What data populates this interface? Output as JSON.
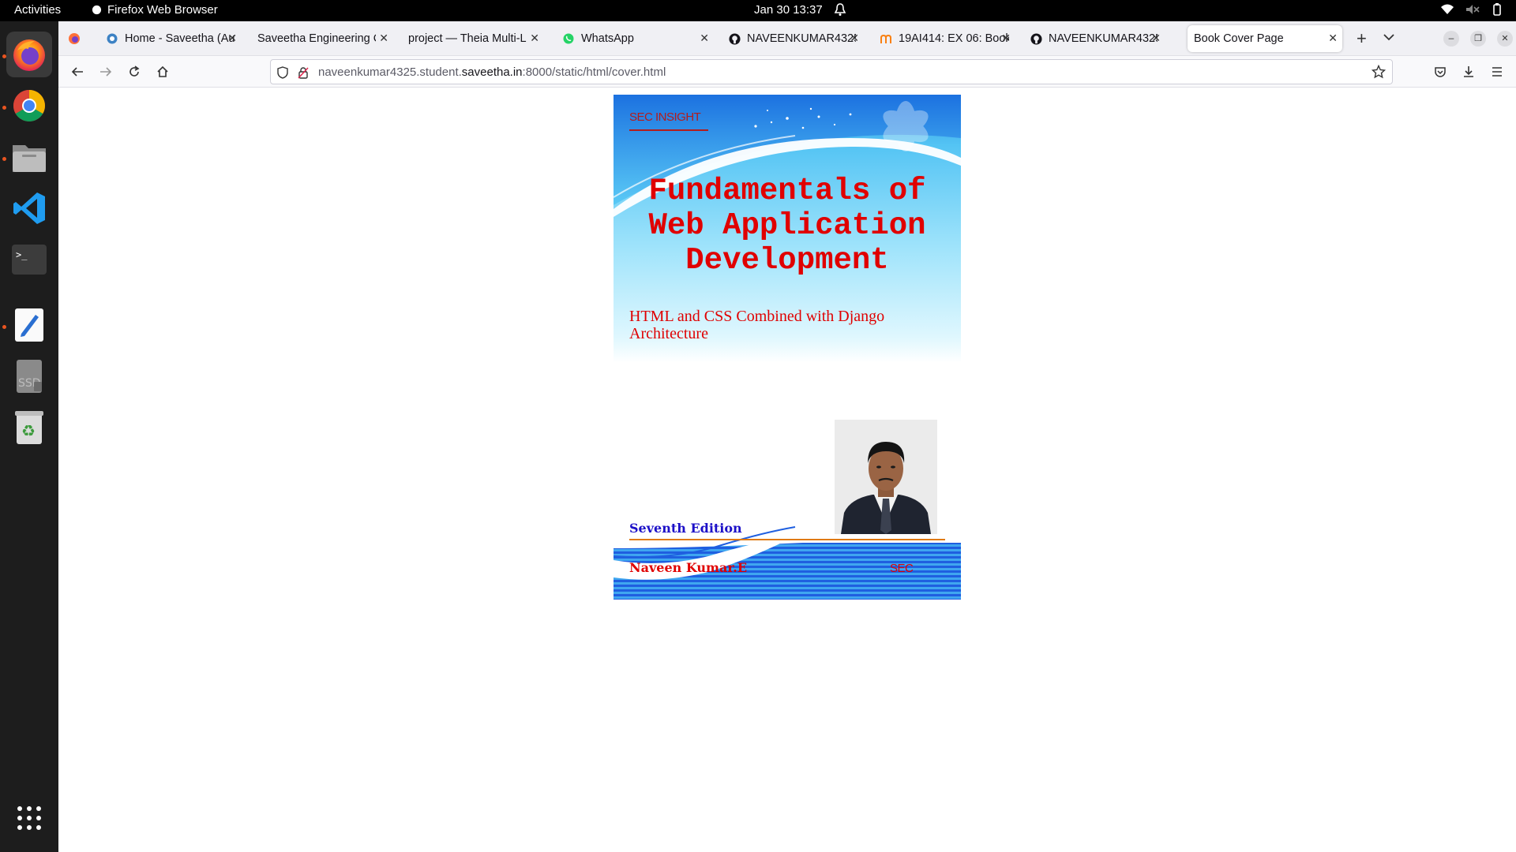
{
  "topbar": {
    "activities": "Activities",
    "app_name": "Firefox Web Browser",
    "clock": "Jan 30  13:37"
  },
  "dock": {
    "items": [
      "firefox",
      "chrome",
      "files",
      "vscode",
      "terminal",
      "text-editor",
      "ssd-drive",
      "trash",
      "app-grid"
    ]
  },
  "tabs": [
    {
      "title": "Home - Saveetha (Aut",
      "icon": "saveetha-icon"
    },
    {
      "title": "Saveetha Engineering Co",
      "icon": "none"
    },
    {
      "title": "project — Theia Multi-La",
      "icon": "none"
    },
    {
      "title": "WhatsApp",
      "icon": "whatsapp-icon"
    },
    {
      "title": "NAVEENKUMAR4325",
      "icon": "github-icon"
    },
    {
      "title": "19AI414: EX 06: Book",
      "icon": "moodle-icon"
    },
    {
      "title": "NAVEENKUMAR4325",
      "icon": "github-icon"
    },
    {
      "title": "Book Cover Page",
      "icon": "none",
      "active": true
    }
  ],
  "url": {
    "prefix": "naveenkumar4325.student.",
    "domain": "saveetha.in",
    "suffix": ":8000/static/html/cover.html"
  },
  "cover": {
    "brand": "SEC INSIGHT",
    "title_lines": [
      "Fundamentals of",
      "Web Application",
      "Development"
    ],
    "subtitle": "HTML and CSS Combined with Django Architecture",
    "edition": "Seventh Edition",
    "author": "Naveen Kumar.E",
    "publisher": "SEC",
    "colors": {
      "title": "#e00000",
      "edition": "#1c10c8",
      "rule": "#e07a10"
    }
  }
}
